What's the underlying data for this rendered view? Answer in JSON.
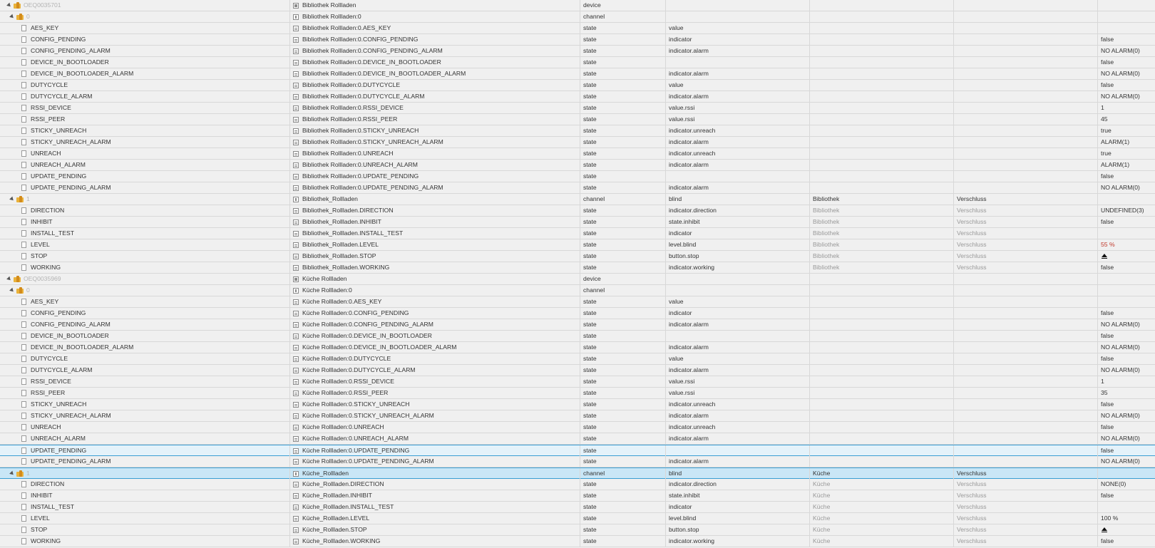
{
  "rows": [
    {
      "type": "device",
      "id": "OEQ0035701",
      "name": "Bibliothek Rollladen",
      "kind": "device",
      "role": "",
      "room": "",
      "func": "",
      "value": ""
    },
    {
      "type": "channel",
      "id": "0",
      "name": "Bibliothek Rollladen:0",
      "kind": "channel",
      "role": "",
      "room": "",
      "func": "",
      "value": ""
    },
    {
      "type": "state",
      "id": "AES_KEY",
      "name": "Bibliothek Rollladen:0.AES_KEY",
      "kind": "state",
      "role": "value",
      "room": "",
      "func": "",
      "value": ""
    },
    {
      "type": "state",
      "id": "CONFIG_PENDING",
      "name": "Bibliothek Rollladen:0.CONFIG_PENDING",
      "kind": "state",
      "role": "indicator",
      "room": "",
      "func": "",
      "value": "false"
    },
    {
      "type": "state",
      "id": "CONFIG_PENDING_ALARM",
      "name": "Bibliothek Rollladen:0.CONFIG_PENDING_ALARM",
      "kind": "state",
      "role": "indicator.alarm",
      "room": "",
      "func": "",
      "value": "NO ALARM(0)"
    },
    {
      "type": "state",
      "id": "DEVICE_IN_BOOTLOADER",
      "name": "Bibliothek Rollladen:0.DEVICE_IN_BOOTLOADER",
      "kind": "state",
      "role": "",
      "room": "",
      "func": "",
      "value": "false"
    },
    {
      "type": "state",
      "id": "DEVICE_IN_BOOTLOADER_ALARM",
      "name": "Bibliothek Rollladen:0.DEVICE_IN_BOOTLOADER_ALARM",
      "kind": "state",
      "role": "indicator.alarm",
      "room": "",
      "func": "",
      "value": "NO ALARM(0)"
    },
    {
      "type": "state",
      "id": "DUTYCYCLE",
      "name": "Bibliothek Rollladen:0.DUTYCYCLE",
      "kind": "state",
      "role": "value",
      "room": "",
      "func": "",
      "value": "false"
    },
    {
      "type": "state",
      "id": "DUTYCYCLE_ALARM",
      "name": "Bibliothek Rollladen:0.DUTYCYCLE_ALARM",
      "kind": "state",
      "role": "indicator.alarm",
      "room": "",
      "func": "",
      "value": "NO ALARM(0)"
    },
    {
      "type": "state",
      "id": "RSSI_DEVICE",
      "name": "Bibliothek Rollladen:0.RSSI_DEVICE",
      "kind": "state",
      "role": "value.rssi",
      "room": "",
      "func": "",
      "value": "1"
    },
    {
      "type": "state",
      "id": "RSSI_PEER",
      "name": "Bibliothek Rollladen:0.RSSI_PEER",
      "kind": "state",
      "role": "value.rssi",
      "room": "",
      "func": "",
      "value": "45"
    },
    {
      "type": "state",
      "id": "STICKY_UNREACH",
      "name": "Bibliothek Rollladen:0.STICKY_UNREACH",
      "kind": "state",
      "role": "indicator.unreach",
      "room": "",
      "func": "",
      "value": "true"
    },
    {
      "type": "state",
      "id": "STICKY_UNREACH_ALARM",
      "name": "Bibliothek Rollladen:0.STICKY_UNREACH_ALARM",
      "kind": "state",
      "role": "indicator.alarm",
      "room": "",
      "func": "",
      "value": "ALARM(1)"
    },
    {
      "type": "state",
      "id": "UNREACH",
      "name": "Bibliothek Rollladen:0.UNREACH",
      "kind": "state",
      "role": "indicator.unreach",
      "room": "",
      "func": "",
      "value": "true"
    },
    {
      "type": "state",
      "id": "UNREACH_ALARM",
      "name": "Bibliothek Rollladen:0.UNREACH_ALARM",
      "kind": "state",
      "role": "indicator.alarm",
      "room": "",
      "func": "",
      "value": "ALARM(1)"
    },
    {
      "type": "state",
      "id": "UPDATE_PENDING",
      "name": "Bibliothek Rollladen:0.UPDATE_PENDING",
      "kind": "state",
      "role": "",
      "room": "",
      "func": "",
      "value": "false"
    },
    {
      "type": "state",
      "id": "UPDATE_PENDING_ALARM",
      "name": "Bibliothek Rollladen:0.UPDATE_PENDING_ALARM",
      "kind": "state",
      "role": "indicator.alarm",
      "room": "",
      "func": "",
      "value": "NO ALARM(0)"
    },
    {
      "type": "channel",
      "id": "1",
      "name": "Bibliothek_Rollladen",
      "kind": "channel",
      "role": "blind",
      "room": "Bibliothek",
      "func": "Verschluss",
      "value": ""
    },
    {
      "type": "state",
      "id": "DIRECTION",
      "name": "Bibliothek_Rollladen.DIRECTION",
      "kind": "state",
      "role": "indicator.direction",
      "room": "Bibliothek",
      "func": "Verschluss",
      "value": "UNDEFINED(3)"
    },
    {
      "type": "state",
      "id": "INHIBIT",
      "name": "Bibliothek_Rollladen.INHIBIT",
      "kind": "state",
      "role": "state.inhibit",
      "room": "Bibliothek",
      "func": "Verschluss",
      "value": "false"
    },
    {
      "type": "state",
      "id": "INSTALL_TEST",
      "name": "Bibliothek_Rollladen.INSTALL_TEST",
      "kind": "state",
      "role": "indicator",
      "room": "Bibliothek",
      "func": "Verschluss",
      "value": ""
    },
    {
      "type": "state",
      "id": "LEVEL",
      "name": "Bibliothek_Rollladen.LEVEL",
      "kind": "state",
      "role": "level.blind",
      "room": "Bibliothek",
      "func": "Verschluss",
      "value": "55 %",
      "valueColor": "#c0392b"
    },
    {
      "type": "state",
      "id": "STOP",
      "name": "Bibliothek_Rollladen.STOP",
      "kind": "state",
      "role": "button.stop",
      "room": "Bibliothek",
      "func": "Verschluss",
      "value": "",
      "button": true
    },
    {
      "type": "state",
      "id": "WORKING",
      "name": "Bibliothek_Rollladen.WORKING",
      "kind": "state",
      "role": "indicator.working",
      "room": "Bibliothek",
      "func": "Verschluss",
      "value": "false"
    },
    {
      "type": "device",
      "id": "OEQ0035969",
      "name": "Küche Rollladen",
      "kind": "device",
      "role": "",
      "room": "",
      "func": "",
      "value": ""
    },
    {
      "type": "channel",
      "id": "0",
      "name": "Küche Rollladen:0",
      "kind": "channel",
      "role": "",
      "room": "",
      "func": "",
      "value": ""
    },
    {
      "type": "state",
      "id": "AES_KEY",
      "name": "Küche Rollladen:0.AES_KEY",
      "kind": "state",
      "role": "value",
      "room": "",
      "func": "",
      "value": ""
    },
    {
      "type": "state",
      "id": "CONFIG_PENDING",
      "name": "Küche Rollladen:0.CONFIG_PENDING",
      "kind": "state",
      "role": "indicator",
      "room": "",
      "func": "",
      "value": "false"
    },
    {
      "type": "state",
      "id": "CONFIG_PENDING_ALARM",
      "name": "Küche Rollladen:0.CONFIG_PENDING_ALARM",
      "kind": "state",
      "role": "indicator.alarm",
      "room": "",
      "func": "",
      "value": "NO ALARM(0)"
    },
    {
      "type": "state",
      "id": "DEVICE_IN_BOOTLOADER",
      "name": "Küche Rollladen:0.DEVICE_IN_BOOTLOADER",
      "kind": "state",
      "role": "",
      "room": "",
      "func": "",
      "value": "false"
    },
    {
      "type": "state",
      "id": "DEVICE_IN_BOOTLOADER_ALARM",
      "name": "Küche Rollladen:0.DEVICE_IN_BOOTLOADER_ALARM",
      "kind": "state",
      "role": "indicator.alarm",
      "room": "",
      "func": "",
      "value": "NO ALARM(0)"
    },
    {
      "type": "state",
      "id": "DUTYCYCLE",
      "name": "Küche Rollladen:0.DUTYCYCLE",
      "kind": "state",
      "role": "value",
      "room": "",
      "func": "",
      "value": "false"
    },
    {
      "type": "state",
      "id": "DUTYCYCLE_ALARM",
      "name": "Küche Rollladen:0.DUTYCYCLE_ALARM",
      "kind": "state",
      "role": "indicator.alarm",
      "room": "",
      "func": "",
      "value": "NO ALARM(0)"
    },
    {
      "type": "state",
      "id": "RSSI_DEVICE",
      "name": "Küche Rollladen:0.RSSI_DEVICE",
      "kind": "state",
      "role": "value.rssi",
      "room": "",
      "func": "",
      "value": "1"
    },
    {
      "type": "state",
      "id": "RSSI_PEER",
      "name": "Küche Rollladen:0.RSSI_PEER",
      "kind": "state",
      "role": "value.rssi",
      "room": "",
      "func": "",
      "value": "35"
    },
    {
      "type": "state",
      "id": "STICKY_UNREACH",
      "name": "Küche Rollladen:0.STICKY_UNREACH",
      "kind": "state",
      "role": "indicator.unreach",
      "room": "",
      "func": "",
      "value": "false"
    },
    {
      "type": "state",
      "id": "STICKY_UNREACH_ALARM",
      "name": "Küche Rollladen:0.STICKY_UNREACH_ALARM",
      "kind": "state",
      "role": "indicator.alarm",
      "room": "",
      "func": "",
      "value": "NO ALARM(0)"
    },
    {
      "type": "state",
      "id": "UNREACH",
      "name": "Küche Rollladen:0.UNREACH",
      "kind": "state",
      "role": "indicator.unreach",
      "room": "",
      "func": "",
      "value": "false"
    },
    {
      "type": "state",
      "id": "UNREACH_ALARM",
      "name": "Küche Rollladen:0.UNREACH_ALARM",
      "kind": "state",
      "role": "indicator.alarm",
      "room": "",
      "func": "",
      "value": "NO ALARM(0)"
    },
    {
      "type": "state",
      "id": "UPDATE_PENDING",
      "name": "Küche Rollladen:0.UPDATE_PENDING",
      "kind": "state",
      "role": "",
      "room": "",
      "func": "",
      "value": "false",
      "highlight": "light"
    },
    {
      "type": "state",
      "id": "UPDATE_PENDING_ALARM",
      "name": "Küche Rollladen:0.UPDATE_PENDING_ALARM",
      "kind": "state",
      "role": "indicator.alarm",
      "room": "",
      "func": "",
      "value": "NO ALARM(0)"
    },
    {
      "type": "channel",
      "id": "1",
      "name": "Küche_Rollladen",
      "kind": "channel",
      "role": "blind",
      "room": "Küche",
      "func": "Verschluss",
      "value": "",
      "highlight": "selected"
    },
    {
      "type": "state",
      "id": "DIRECTION",
      "name": "Küche_Rollladen.DIRECTION",
      "kind": "state",
      "role": "indicator.direction",
      "room": "Küche",
      "func": "Verschluss",
      "value": "NONE(0)"
    },
    {
      "type": "state",
      "id": "INHIBIT",
      "name": "Küche_Rollladen.INHIBIT",
      "kind": "state",
      "role": "state.inhibit",
      "room": "Küche",
      "func": "Verschluss",
      "value": "false"
    },
    {
      "type": "state",
      "id": "INSTALL_TEST",
      "name": "Küche_Rollladen.INSTALL_TEST",
      "kind": "state",
      "role": "indicator",
      "room": "Küche",
      "func": "Verschluss",
      "value": ""
    },
    {
      "type": "state",
      "id": "LEVEL",
      "name": "Küche_Rollladen.LEVEL",
      "kind": "state",
      "role": "level.blind",
      "room": "Küche",
      "func": "Verschluss",
      "value": "100 %"
    },
    {
      "type": "state",
      "id": "STOP",
      "name": "Küche_Rollladen.STOP",
      "kind": "state",
      "role": "button.stop",
      "room": "Küche",
      "func": "Verschluss",
      "value": "",
      "button": true
    },
    {
      "type": "state",
      "id": "WORKING",
      "name": "Küche_Rollladen.WORKING",
      "kind": "state",
      "role": "indicator.working",
      "room": "Küche",
      "func": "Verschluss",
      "value": "false"
    }
  ]
}
